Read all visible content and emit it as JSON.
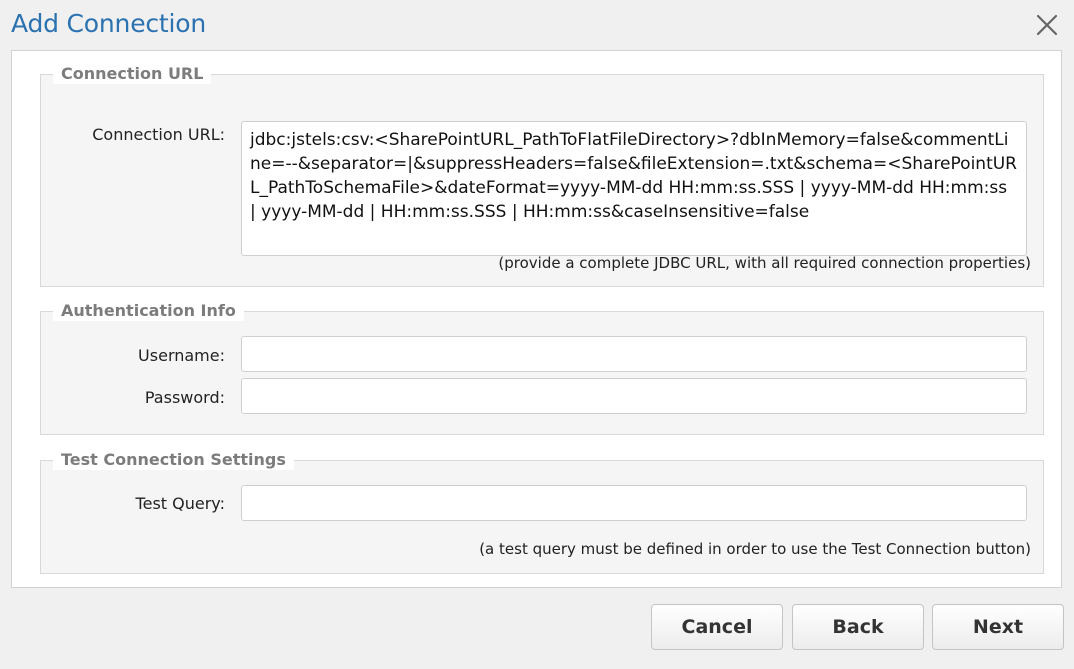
{
  "dialog": {
    "title": "Add Connection"
  },
  "connection_url": {
    "legend": "Connection URL",
    "label": "Connection URL:",
    "value": "jdbc:jstels:csv:<SharePointURL_PathToFlatFileDirectory>?dbInMemory=false&commentLine=--&separator=|&suppressHeaders=false&fileExtension=.txt&schema=<SharePointURL_PathToSchemaFile>&dateFormat=yyyy-MM-dd HH:mm:ss.SSS | yyyy-MM-dd HH:mm:ss | yyyy-MM-dd | HH:mm:ss.SSS | HH:mm:ss&caseInsensitive=false",
    "hint": "(provide a complete JDBC URL, with all required connection properties)"
  },
  "auth": {
    "legend": "Authentication Info",
    "username_label": "Username:",
    "username_value": "",
    "password_label": "Password:",
    "password_value": ""
  },
  "test": {
    "legend": "Test Connection Settings",
    "query_label": "Test Query:",
    "query_value": "",
    "hint": "(a test query must be defined in order to use the Test Connection button)"
  },
  "buttons": {
    "cancel": "Cancel",
    "back": "Back",
    "next": "Next"
  }
}
